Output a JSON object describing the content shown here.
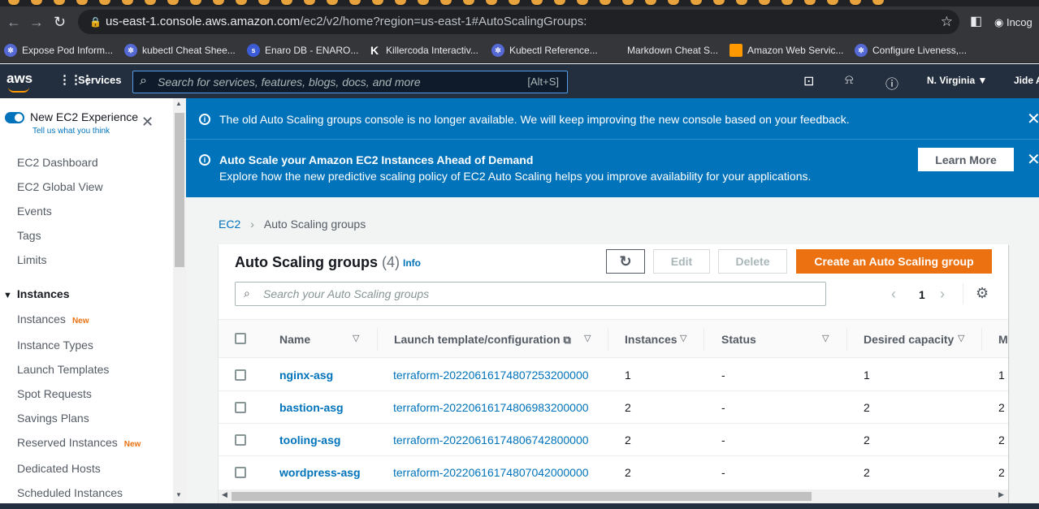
{
  "browser": {
    "url_host": "us-east-1.console.aws.amazon.com",
    "url_path": "/ec2/v2/home?region=us-east-1#AutoScalingGroups:",
    "profile": "Incog"
  },
  "bookmarks": [
    {
      "label": "Expose Pod Inform...",
      "favicon": "k8s"
    },
    {
      "label": "kubectl Cheat Shee...",
      "favicon": "k8s"
    },
    {
      "label": "Enaro DB - ENARO...",
      "favicon": "s"
    },
    {
      "label": "Killercoda Interactiv...",
      "favicon": "K"
    },
    {
      "label": "Kubectl Reference...",
      "favicon": "k8s"
    },
    {
      "label": "Markdown Cheat S...",
      "favicon": "md"
    },
    {
      "label": "Amazon Web Servic...",
      "favicon": "aws"
    },
    {
      "label": "Configure Liveness,...",
      "favicon": "k8s"
    }
  ],
  "aws_header": {
    "logo": "aws",
    "services": "Services",
    "search_placeholder": "Search for services, features, blogs, docs, and more",
    "search_shortcut": "[Alt+S]",
    "region": "N. Virginia ▼",
    "user": "Jide A"
  },
  "sidebar": {
    "toggle_label": "New EC2 Experience",
    "toggle_sub": "Tell us what you think",
    "items_top": [
      "EC2 Dashboard",
      "EC2 Global View",
      "Events",
      "Tags",
      "Limits"
    ],
    "section": "Instances",
    "items_instances": [
      {
        "label": "Instances",
        "badge": "New"
      },
      {
        "label": "Instance Types",
        "badge": ""
      },
      {
        "label": "Launch Templates",
        "badge": ""
      },
      {
        "label": "Spot Requests",
        "badge": ""
      },
      {
        "label": "Savings Plans",
        "badge": ""
      },
      {
        "label": "Reserved Instances",
        "badge": "New"
      },
      {
        "label": "Dedicated Hosts",
        "badge": ""
      },
      {
        "label": "Scheduled Instances",
        "badge": ""
      }
    ]
  },
  "flash": {
    "msg1": "The old Auto Scaling groups console is no longer available. We will keep improving the new console based on your feedback.",
    "msg2_title": "Auto Scale your Amazon EC2 Instances Ahead of Demand",
    "msg2_body": "Explore how the new predictive scaling policy of EC2 Auto Scaling helps you improve availability for your applications.",
    "learn_more": "Learn More"
  },
  "breadcrumb": {
    "root": "EC2",
    "current": "Auto Scaling groups"
  },
  "panel": {
    "title": "Auto Scaling groups",
    "count": "(4)",
    "info": "Info",
    "edit": "Edit",
    "delete": "Delete",
    "create": "Create an Auto Scaling group",
    "search_placeholder": "Search your Auto Scaling groups",
    "page": "1"
  },
  "table": {
    "columns": [
      "Name",
      "Launch template/configuration",
      "Instances",
      "Status",
      "Desired capacity",
      "M"
    ],
    "rows": [
      {
        "name": "nginx-asg",
        "template": "terraform-20220616174807253200000",
        "instances": "1",
        "status": "-",
        "desired": "1",
        "min": "1"
      },
      {
        "name": "bastion-asg",
        "template": "terraform-20220616174806983200000",
        "instances": "2",
        "status": "-",
        "desired": "2",
        "min": "2"
      },
      {
        "name": "tooling-asg",
        "template": "terraform-20220616174806742800000",
        "instances": "2",
        "status": "-",
        "desired": "2",
        "min": "2"
      },
      {
        "name": "wordpress-asg",
        "template": "terraform-20220616174807042000000",
        "instances": "2",
        "status": "-",
        "desired": "2",
        "min": "2"
      }
    ]
  },
  "colors": {
    "aws_nav": "#232f3e",
    "flash_blue": "#0073bb",
    "primary_orange": "#ec7211",
    "link": "#0073bb"
  }
}
